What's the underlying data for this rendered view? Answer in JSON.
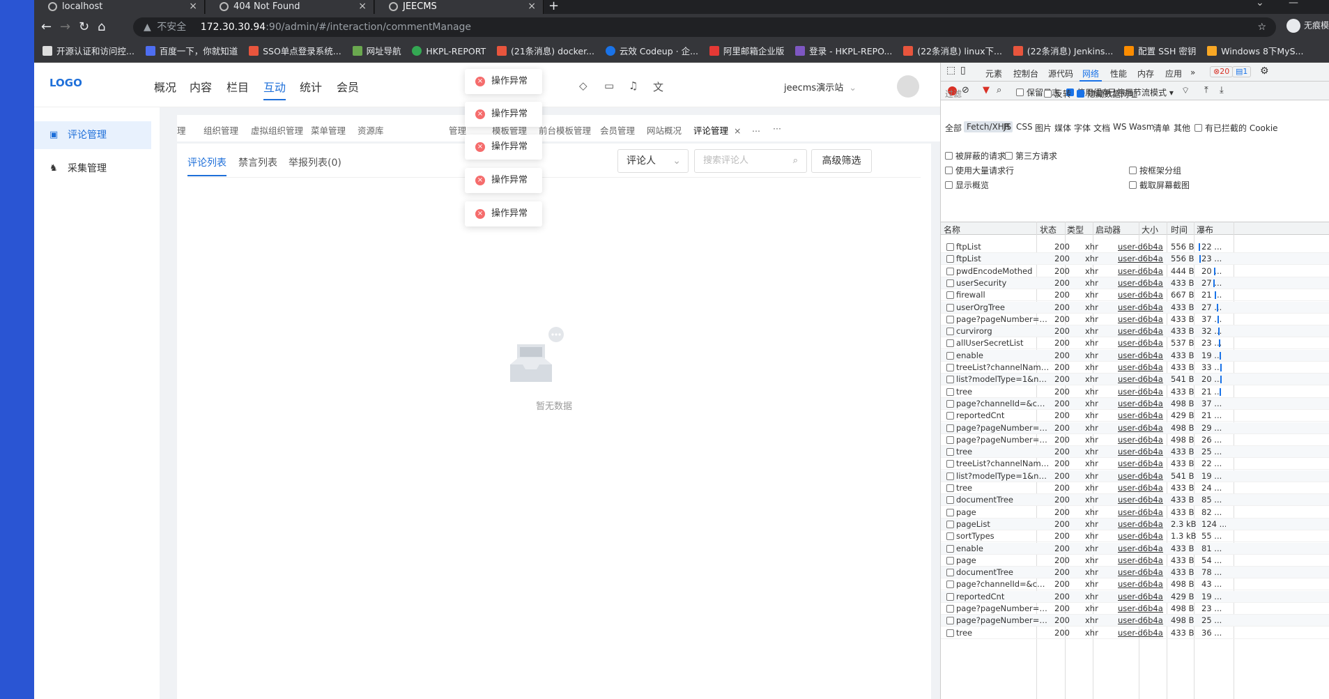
{
  "browser": {
    "tabs": [
      {
        "title": "localhost"
      },
      {
        "title": "404 Not Found"
      },
      {
        "title": "JEECMS"
      }
    ],
    "address": {
      "security": "不安全",
      "host": "172.30.30.94",
      "path": ":90/admin/#/interaction/commentManage"
    },
    "profile_label": "无痕模",
    "bookmarks": [
      "开源认证和访问控...",
      "百度一下，你就知道",
      "SSO单点登录系统...",
      "网址导航",
      "HKPL-REPORT",
      "(21条消息) docker...",
      "云效 Codeup · 企...",
      "阿里邮箱企业版",
      "登录 - HKPL-REPO...",
      "(22条消息) linux下...",
      "(22条消息) Jenkins...",
      "配置 SSH 密钥",
      "Windows 8下MyS..."
    ]
  },
  "app": {
    "logo": "LOGO",
    "topnav": [
      "概况",
      "内容",
      "栏目",
      "互动",
      "统计",
      "会员"
    ],
    "topnav_active": 3,
    "site": "jeecms演示站",
    "sidebar": [
      "评论管理",
      "采集管理"
    ],
    "page_tabs": [
      "理",
      "组织管理",
      "虚拟组织管理",
      "菜单管理",
      "资源库",
      "管理",
      "模板管理",
      "前台模板管理",
      "会员管理",
      "网站概况",
      "评论管理",
      "...",
      "···"
    ],
    "sub_tabs": [
      "评论列表",
      "禁言列表",
      "举报列表(0)"
    ],
    "select_label": "评论人",
    "search_placeholder": "搜索评论人",
    "advanced_filter": "高级筛选",
    "empty_text": "暂无数据",
    "toast_text": "操作异常",
    "toast_count": 5
  },
  "devtools": {
    "tabs": [
      "元素",
      "控制台",
      "源代码",
      "网络",
      "性能",
      "内存",
      "应用"
    ],
    "active_tab": "网络",
    "errors": "20",
    "messages": "1",
    "toolbar": {
      "preserve_log": "保留日志",
      "disable_cache": "停用缓存",
      "throttle": "已停用节流模式"
    },
    "filter_placeholder": "过滤",
    "invert": "反转",
    "hide_data_urls": "隐藏数据网址",
    "type_filters": [
      "全部",
      "Fetch/XHR",
      "JS",
      "CSS",
      "图片",
      "媒体",
      "字体",
      "文档",
      "WS",
      "Wasm",
      "清单",
      "其他"
    ],
    "blocked_cookies": "有已拦截的 Cookie",
    "blocked_requests": "被屏蔽的请求",
    "third_party": "第三方请求",
    "big_rows": "使用大量请求行",
    "group_by_frame": "按框架分组",
    "overview": "显示概览",
    "screenshots": "截取屏幕截图",
    "columns": [
      "名称",
      "状态",
      "类型",
      "启动器",
      "大小",
      "时间",
      "瀑布"
    ],
    "rows": [
      {
        "name": "ftpList",
        "status": "200",
        "type": "xhr",
        "initiator": "user-d6b4a...",
        "size": "556 B",
        "time": "22 ..."
      },
      {
        "name": "ftpList",
        "status": "200",
        "type": "xhr",
        "initiator": "user-d6b4a...",
        "size": "556 B",
        "time": "23 ..."
      },
      {
        "name": "pwdEncodeMothed",
        "status": "200",
        "type": "xhr",
        "initiator": "user-d6b4a...",
        "size": "444 B",
        "time": "20 ..."
      },
      {
        "name": "userSecurity",
        "status": "200",
        "type": "xhr",
        "initiator": "user-d6b4a...",
        "size": "433 B",
        "time": "27 ..."
      },
      {
        "name": "firewall",
        "status": "200",
        "type": "xhr",
        "initiator": "user-d6b4a...",
        "size": "667 B",
        "time": "21 ..."
      },
      {
        "name": "userOrgTree",
        "status": "200",
        "type": "xhr",
        "initiator": "user-d6b4a...",
        "size": "433 B",
        "time": "27 ..."
      },
      {
        "name": "page?pageNumber=1&...",
        "status": "200",
        "type": "xhr",
        "initiator": "user-d6b4a...",
        "size": "433 B",
        "time": "37 ..."
      },
      {
        "name": "curvirorg",
        "status": "200",
        "type": "xhr",
        "initiator": "user-d6b4a...",
        "size": "433 B",
        "time": "32 ..."
      },
      {
        "name": "allUserSecretList",
        "status": "200",
        "type": "xhr",
        "initiator": "user-d6b4a...",
        "size": "537 B",
        "time": "23 ..."
      },
      {
        "name": "enable",
        "status": "200",
        "type": "xhr",
        "initiator": "user-d6b4a...",
        "size": "433 B",
        "time": "19 ..."
      },
      {
        "name": "treeList?channelName=",
        "status": "200",
        "type": "xhr",
        "initiator": "user-d6b4a...",
        "size": "433 B",
        "time": "33 ..."
      },
      {
        "name": "list?modelType=1&nam...",
        "status": "200",
        "type": "xhr",
        "initiator": "user-d6b4a...",
        "size": "541 B",
        "time": "20 ..."
      },
      {
        "name": "tree",
        "status": "200",
        "type": "xhr",
        "initiator": "user-d6b4a...",
        "size": "433 B",
        "time": "21 ..."
      },
      {
        "name": "page?channelId=&cont...",
        "status": "200",
        "type": "xhr",
        "initiator": "user-d6b4a...",
        "size": "498 B",
        "time": "37 ..."
      },
      {
        "name": "reportedCnt",
        "status": "200",
        "type": "xhr",
        "initiator": "user-d6b4a...",
        "size": "429 B",
        "time": "21 ..."
      },
      {
        "name": "page?pageNumber=1&...",
        "status": "200",
        "type": "xhr",
        "initiator": "user-d6b4a...",
        "size": "498 B",
        "time": "29 ..."
      },
      {
        "name": "page?pageNumber=1&...",
        "status": "200",
        "type": "xhr",
        "initiator": "user-d6b4a...",
        "size": "498 B",
        "time": "26 ..."
      },
      {
        "name": "tree",
        "status": "200",
        "type": "xhr",
        "initiator": "user-d6b4a...",
        "size": "433 B",
        "time": "25 ..."
      },
      {
        "name": "treeList?channelName=",
        "status": "200",
        "type": "xhr",
        "initiator": "user-d6b4a...",
        "size": "433 B",
        "time": "22 ..."
      },
      {
        "name": "list?modelType=1&nam...",
        "status": "200",
        "type": "xhr",
        "initiator": "user-d6b4a...",
        "size": "541 B",
        "time": "19 ..."
      },
      {
        "name": "tree",
        "status": "200",
        "type": "xhr",
        "initiator": "user-d6b4a...",
        "size": "433 B",
        "time": "24 ..."
      },
      {
        "name": "documentTree",
        "status": "200",
        "type": "xhr",
        "initiator": "user-d6b4a...",
        "size": "433 B",
        "time": "85 ..."
      },
      {
        "name": "page",
        "status": "200",
        "type": "xhr",
        "initiator": "user-d6b4a...",
        "size": "433 B",
        "time": "82 ..."
      },
      {
        "name": "pageList",
        "status": "200",
        "type": "xhr",
        "initiator": "user-d6b4a...",
        "size": "2.3 kB",
        "time": "124 ..."
      },
      {
        "name": "sortTypes",
        "status": "200",
        "type": "xhr",
        "initiator": "user-d6b4a...",
        "size": "1.3 kB",
        "time": "55 ..."
      },
      {
        "name": "enable",
        "status": "200",
        "type": "xhr",
        "initiator": "user-d6b4a...",
        "size": "433 B",
        "time": "81 ..."
      },
      {
        "name": "page",
        "status": "200",
        "type": "xhr",
        "initiator": "user-d6b4a...",
        "size": "433 B",
        "time": "54 ..."
      },
      {
        "name": "documentTree",
        "status": "200",
        "type": "xhr",
        "initiator": "user-d6b4a...",
        "size": "433 B",
        "time": "78 ..."
      },
      {
        "name": "page?channelId=&cont...",
        "status": "200",
        "type": "xhr",
        "initiator": "user-d6b4a...",
        "size": "498 B",
        "time": "43 ..."
      },
      {
        "name": "reportedCnt",
        "status": "200",
        "type": "xhr",
        "initiator": "user-d6b4a...",
        "size": "429 B",
        "time": "19 ..."
      },
      {
        "name": "page?pageNumber=1&...",
        "status": "200",
        "type": "xhr",
        "initiator": "user-d6b4a...",
        "size": "498 B",
        "time": "23 ..."
      },
      {
        "name": "page?pageNumber=1&...",
        "status": "200",
        "type": "xhr",
        "initiator": "user-d6b4a...",
        "size": "498 B",
        "time": "25 ..."
      },
      {
        "name": "tree",
        "status": "200",
        "type": "xhr",
        "initiator": "user-d6b4a...",
        "size": "433 B",
        "time": "36 ..."
      }
    ]
  }
}
